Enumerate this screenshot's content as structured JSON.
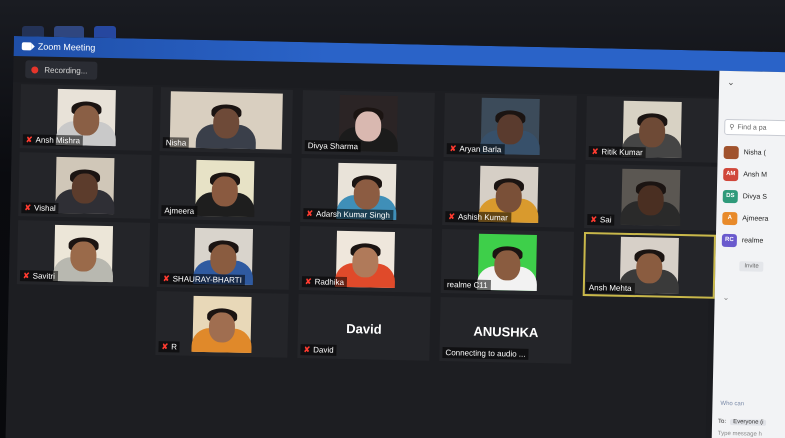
{
  "window": {
    "title": "Zoom Meeting"
  },
  "recording": {
    "label": "Recording..."
  },
  "tiles": [
    {
      "name": "Ansh Mishra",
      "muted": true,
      "video": true,
      "skin": "#8a5f45",
      "shirt": "#c9c9c9",
      "bg": "#e8e2d8"
    },
    {
      "name": "Nisha",
      "muted": false,
      "video": true,
      "skin": "#6e4a38",
      "shirt": "#3a3f4a",
      "bg": "#d9cfc0"
    },
    {
      "name": "Divya Sharma",
      "muted": false,
      "video": true,
      "skin": "#d9b8b0",
      "shirt": "#1b1b1b",
      "bg": "#2b2425"
    },
    {
      "name": "Aryan Barla",
      "muted": true,
      "video": true,
      "skin": "#5a3b2e",
      "shirt": "#37506a",
      "bg": "#3c4b5a"
    },
    {
      "name": "Ritik Kumar",
      "muted": true,
      "video": true,
      "skin": "#6e4a36",
      "shirt": "#454545",
      "bg": "#d8d2c4"
    },
    {
      "name": "Vishal",
      "muted": true,
      "video": true,
      "skin": "#5c3c2c",
      "shirt": "#2f2f35",
      "bg": "#d0c7b8"
    },
    {
      "name": "Ajmeera",
      "muted": false,
      "video": true,
      "skin": "#8a5a40",
      "shirt": "#1e1e1e",
      "bg": "#e7e2c6"
    },
    {
      "name": "Adarsh Kumar Singh",
      "muted": true,
      "video": true,
      "skin": "#8c5c42",
      "shirt": "#3f8fb8",
      "bg": "#e9e3d9"
    },
    {
      "name": "Ashish Kumar",
      "muted": true,
      "video": true,
      "skin": "#7a5038",
      "shirt": "#d99a2d",
      "bg": "#d6cfc6"
    },
    {
      "name": "Sai",
      "muted": true,
      "video": true,
      "skin": "#4a2f22",
      "shirt": "#2a2a2a",
      "bg": "#5b5752"
    },
    {
      "name": "Savitri",
      "muted": true,
      "video": true,
      "skin": "#9a6a4a",
      "shirt": "#b8b8b0",
      "bg": "#ece6d8"
    },
    {
      "name": "SHAURAY-BHARTI",
      "muted": true,
      "video": true,
      "skin": "#8a5c40",
      "shirt": "#2f5aa0",
      "bg": "#d9d4cc"
    },
    {
      "name": "Radhika",
      "muted": true,
      "video": true,
      "skin": "#b07a5a",
      "shirt": "#e04a2a",
      "bg": "#efe7dc"
    },
    {
      "name": "realme C11",
      "muted": false,
      "video": true,
      "skin": "#8a5c40",
      "shirt": "#f2f2f2",
      "bg": "#3ecf4a"
    },
    {
      "name": "Ansh Mehta",
      "muted": false,
      "video": true,
      "skin": "#8a5c40",
      "shirt": "#3a3a3a",
      "bg": "#d7d0c8",
      "active": true
    },
    {
      "name": "R",
      "muted": true,
      "video": true,
      "skin": "#a06e50",
      "shirt": "#e0892a",
      "bg": "#e8d8b8"
    },
    {
      "name": "David",
      "muted": true,
      "video": false,
      "big": "David"
    },
    {
      "name": "Connecting to audio ...",
      "muted": false,
      "video": false,
      "big": "ANUSHKA"
    }
  ],
  "panel": {
    "search_placeholder": "Find a pa",
    "participants": [
      {
        "initials": "",
        "name": "Nisha (",
        "color": "#a0522d",
        "photo": true
      },
      {
        "initials": "AM",
        "name": "Ansh M",
        "color": "#d0473a"
      },
      {
        "initials": "DS",
        "name": "Divya S",
        "color": "#2f9a7a"
      },
      {
        "initials": "A",
        "name": "Ajmeera",
        "color": "#e88a2a"
      },
      {
        "initials": "RC",
        "name": "realme",
        "color": "#6a5acd"
      }
    ],
    "invite_label": "Invite",
    "chat_hint": "Who can",
    "to_label": "To:",
    "to_value": "Everyone (i",
    "message_placeholder": "Type message h"
  }
}
